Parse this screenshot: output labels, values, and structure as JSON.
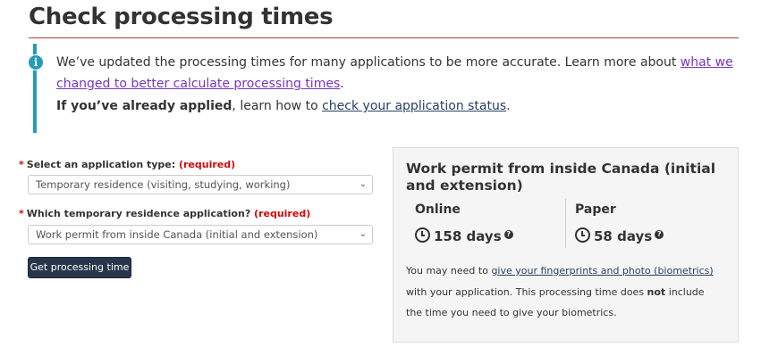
{
  "page": {
    "title": "Check processing times"
  },
  "alert": {
    "line1_text": "We’ve updated the processing times for many applications to be more accurate. Learn more about ",
    "link1_part1": "what we",
    "link1_part2": "changed to better calculate processing times",
    "line2_end": ".",
    "applied_bold": "If you’ve already applied",
    "applied_text": ", learn how to ",
    "status_link": "check your application status",
    "line3_end": ".",
    "icon": "info-icon"
  },
  "form": {
    "required_marker": "*",
    "field1": {
      "label": "Select an application type:",
      "required": "(required)",
      "value": "Temporary residence (visiting, studying, working)"
    },
    "field2": {
      "label": "Which temporary residence application?",
      "required": "(required)",
      "value": "Work permit from inside Canada (initial and extension)"
    },
    "submit_label": "Get processing time"
  },
  "result": {
    "title": "Work permit from inside Canada (initial and extension)",
    "online": {
      "label": "Online",
      "value": "158 days"
    },
    "paper": {
      "label": "Paper",
      "value": "58 days"
    },
    "help_glyph": "?",
    "note_pre": "You may need to ",
    "note_link": "give your fingerprints and photo (biometrics)",
    "note_mid": "with your application. This processing time does ",
    "note_bold": "not",
    "note_post": " include",
    "note_end": "the time you need to give your biometrics."
  },
  "colors": {
    "accent_rule": "#af3c43",
    "info_bar": "#269abc",
    "button_bg": "#26374a",
    "required_red": "#d3080c",
    "visited_link": "#7834bc"
  }
}
